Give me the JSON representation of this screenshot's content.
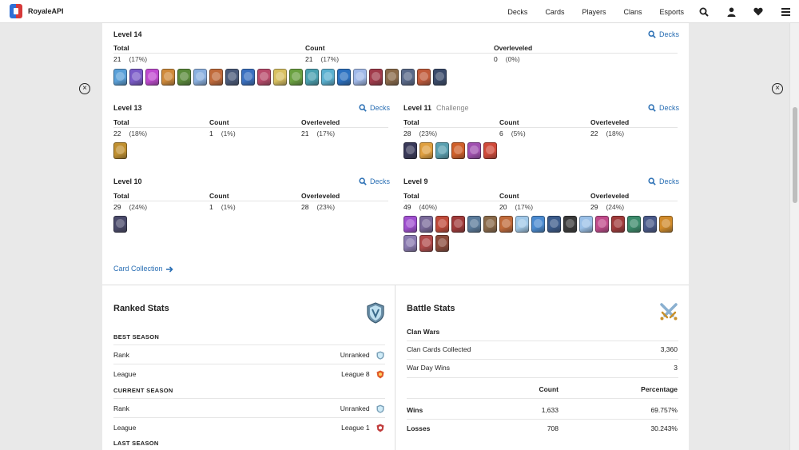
{
  "nav": {
    "brand": "RoyaleAPI",
    "links": [
      "Decks",
      "Cards",
      "Players",
      "Clans",
      "Esports"
    ]
  },
  "levels": {
    "l14": {
      "title": "Level 14",
      "decks": "Decks",
      "total_label": "Total",
      "count_label": "Count",
      "over_label": "Overleveled",
      "total": "21",
      "total_pct": "(17%)",
      "count": "21",
      "count_pct": "(17%)",
      "over": "0",
      "over_pct": "(0%)"
    },
    "l13": {
      "title": "Level 13",
      "decks": "Decks",
      "total_label": "Total",
      "count_label": "Count",
      "over_label": "Overleveled",
      "total": "22",
      "total_pct": "(18%)",
      "count": "1",
      "count_pct": "(1%)",
      "over": "21",
      "over_pct": "(17%)"
    },
    "l11": {
      "title": "Level 11",
      "subtitle": "Challenge",
      "decks": "Decks",
      "total_label": "Total",
      "count_label": "Count",
      "over_label": "Overleveled",
      "total": "28",
      "total_pct": "(23%)",
      "count": "6",
      "count_pct": "(5%)",
      "over": "22",
      "over_pct": "(18%)"
    },
    "l10": {
      "title": "Level 10",
      "decks": "Decks",
      "total_label": "Total",
      "count_label": "Count",
      "over_label": "Overleveled",
      "total": "29",
      "total_pct": "(24%)",
      "count": "1",
      "count_pct": "(1%)",
      "over": "28",
      "over_pct": "(23%)"
    },
    "l9": {
      "title": "Level 9",
      "decks": "Decks",
      "total_label": "Total",
      "count_label": "Count",
      "over_label": "Overleveled",
      "total": "49",
      "total_pct": "(40%)",
      "count": "20",
      "count_pct": "(17%)",
      "over": "29",
      "over_pct": "(24%)"
    }
  },
  "card_colors": {
    "l14": [
      "#5aa0d8",
      "#7a5bc8",
      "#c04ad0",
      "#d08a3a",
      "#5a8a3a",
      "#8ab0e0",
      "#c06a3a",
      "#4a5a7a",
      "#3a70c0",
      "#b84a6a",
      "#d8c060",
      "#6aa040",
      "#4aa0b0",
      "#5ab0d0",
      "#2a70c0",
      "#a0b8e8",
      "#a03a4a",
      "#8a6a4a",
      "#5a6a8a",
      "#c05a3a",
      "#3a4a6a"
    ],
    "l13": [
      "#c09030"
    ],
    "l11": [
      "#3a3a5a",
      "#e0a040",
      "#5aa0b0",
      "#d0602a",
      "#a050b0",
      "#d04a3a"
    ],
    "l10": [
      "#4a4a6a"
    ],
    "l9": [
      "#a050d0",
      "#7a6a9a",
      "#c04a3a",
      "#a03a3a",
      "#5a7a9a",
      "#8a6a4a",
      "#c06a3a",
      "#a0c8e8",
      "#4a8ad0",
      "#3a5a8a",
      "#3a3a3a",
      "#9ac0e8",
      "#c04a8a",
      "#a03a3a",
      "#3a8a6a",
      "#4a5a8a",
      "#d08a2a",
      "#8a7ab0",
      "#b04a4a",
      "#8a4a3a"
    ]
  },
  "collection_link": "Card Collection",
  "ranked": {
    "title": "Ranked Stats",
    "best_season": "BEST SEASON",
    "current_season": "CURRENT SEASON",
    "last_season": "LAST SEASON",
    "rank_label": "Rank",
    "league_label": "League",
    "best_rank": "Unranked",
    "best_league": "League 8",
    "current_rank": "Unranked",
    "current_league": "League 1"
  },
  "battle": {
    "title": "Battle Stats",
    "clan_wars": "Clan Wars",
    "clan_cards_label": "Clan Cards Collected",
    "clan_cards_value": "3,360",
    "war_day_label": "War Day Wins",
    "war_day_value": "3",
    "count_header": "Count",
    "pct_header": "Percentage",
    "wins_label": "Wins",
    "wins_count": "1,633",
    "wins_pct": "69.757%",
    "losses_label": "Losses",
    "losses_count": "708",
    "losses_pct": "30.243%"
  }
}
